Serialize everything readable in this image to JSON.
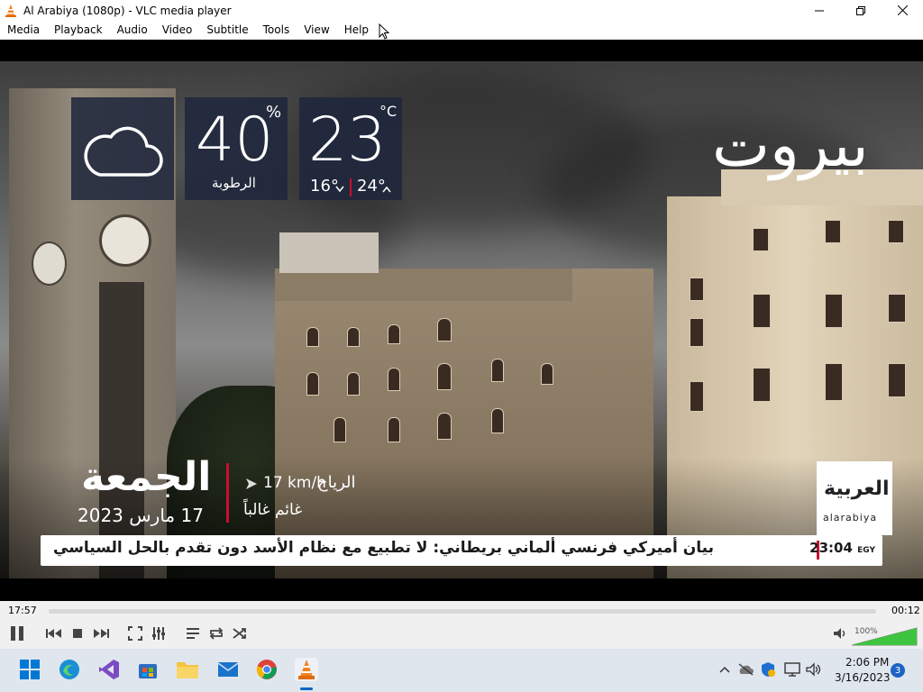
{
  "window": {
    "title": "Al Arabiya (1080p) - VLC media player"
  },
  "menu": [
    "Media",
    "Playback",
    "Audio",
    "Video",
    "Subtitle",
    "Tools",
    "View",
    "Help"
  ],
  "overlay": {
    "city": "بيروت",
    "temperature": "23",
    "temp_unit": "°C",
    "temp_low": "16°",
    "temp_high": "24°",
    "humidity": "40",
    "humidity_unit": "%",
    "humidity_label": "الرطوبة",
    "wind_label": "الرياح",
    "wind_value": "17 km/h",
    "condition": "غائم غالباً",
    "day": "الجمعة",
    "date": "17 مارس 2023",
    "channel_logo_ar": "العربية",
    "channel_logo_en": "alarabiya",
    "ticker_text": "بيان أميركي فرنسي ألماني بريطاني: لا تطبيع مع نظام الأسد دون تقدم بالحل السياسي",
    "ticker_time": "23:04",
    "ticker_tz": "EGY"
  },
  "player": {
    "elapsed": "17:57",
    "remaining": "00:12",
    "volume": "100%",
    "volume_level": 1.0
  },
  "taskbar": {
    "time": "2:06 PM",
    "date": "3/16/2023",
    "notifications": "3"
  },
  "colors": {
    "panel": "#1e263c",
    "accent_red": "#c8102e",
    "volume_green": "#3ec43e",
    "vlc_orange": "#f58220"
  }
}
